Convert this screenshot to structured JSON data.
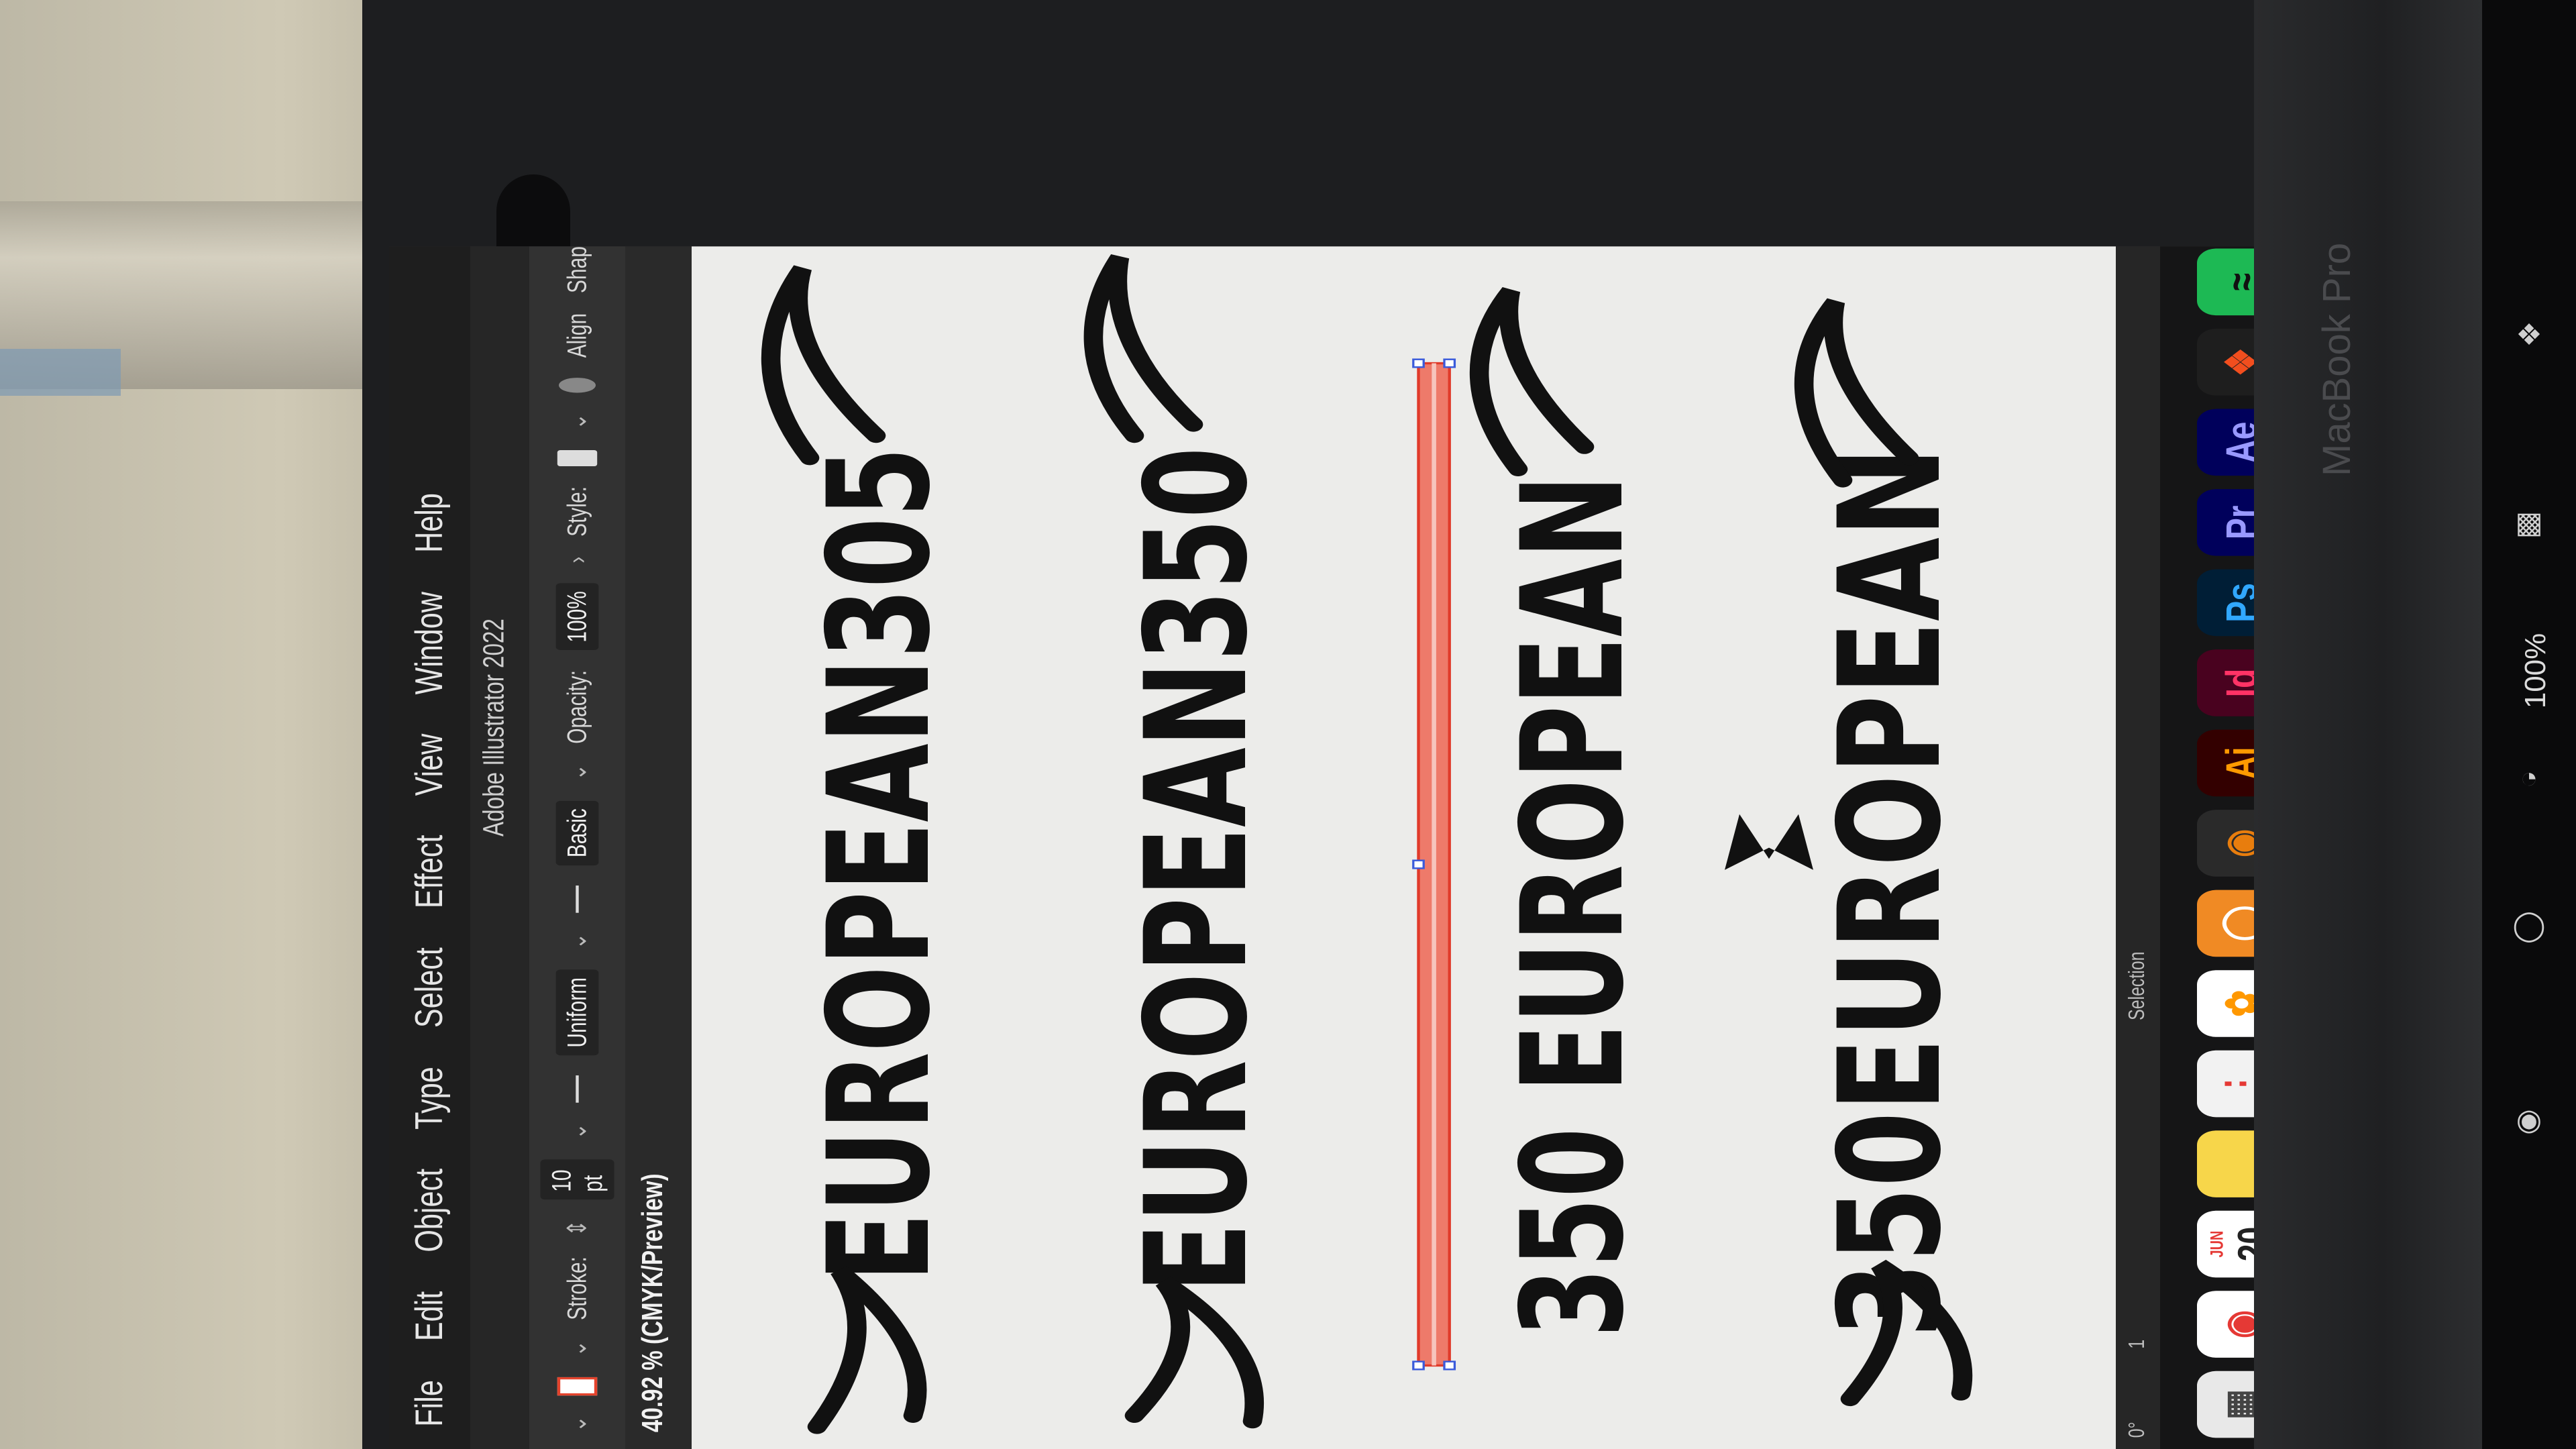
{
  "menu": {
    "items": [
      "File",
      "Edit",
      "Object",
      "Type",
      "Select",
      "Effect",
      "View",
      "Window",
      "Help"
    ]
  },
  "app_title": "Adobe Illustrator 2022",
  "control_bar": {
    "stroke_label": "Stroke:",
    "stroke_value": "10 pt",
    "profile_value": "Uniform",
    "brush_value": "Basic",
    "opacity_label": "Opacity:",
    "opacity_value": "100%",
    "style_label": "Style:",
    "align_label": "Align",
    "shape_label": "Shap"
  },
  "document_tab": "40.92 % (CMYK/Preview)",
  "status": {
    "angle": "0°",
    "page": "1",
    "tool": "Selection"
  },
  "artwork": {
    "logos": [
      "EUROPEAN305",
      "EUROPEAN350",
      "350 EUROPEAN",
      "350EUROPEAN"
    ]
  },
  "dock": {
    "apps": [
      {
        "name": "launchpad-icon",
        "label": "",
        "color": "#e8e8e8"
      },
      {
        "name": "chrome-icon",
        "label": "",
        "color": "#ffffff"
      },
      {
        "name": "calendar-icon",
        "label": "20",
        "month": "JUN",
        "color": "#ffffff"
      },
      {
        "name": "notes-icon",
        "label": "",
        "color": "#f7d64a"
      },
      {
        "name": "reminders-icon",
        "label": "",
        "color": "#f2f2f2"
      },
      {
        "name": "photos-icon",
        "label": "",
        "color": "#ffffff"
      },
      {
        "name": "vpn-icon",
        "label": "",
        "color": "#f08a24"
      },
      {
        "name": "blender-icon",
        "label": "",
        "color": "#e87d0d"
      },
      {
        "name": "illustrator-icon",
        "label": "Ai",
        "color": "#330000"
      },
      {
        "name": "indesign-icon",
        "label": "Id",
        "color": "#49021f"
      },
      {
        "name": "photoshop-icon",
        "label": "Ps",
        "color": "#001e36"
      },
      {
        "name": "premiere-icon",
        "label": "Pr",
        "color": "#00005b"
      },
      {
        "name": "after-effects-icon",
        "label": "Ae",
        "color": "#00005b"
      },
      {
        "name": "figma-icon",
        "label": "",
        "color": "#1e1e1e"
      },
      {
        "name": "spotify-icon",
        "label": "",
        "color": "#1db954"
      },
      {
        "name": "facetime-icon",
        "label": "",
        "color": "#34c759"
      }
    ]
  },
  "hardware": {
    "laptop_label": "MacBook Pro",
    "touchbar_zoom": "100%"
  }
}
